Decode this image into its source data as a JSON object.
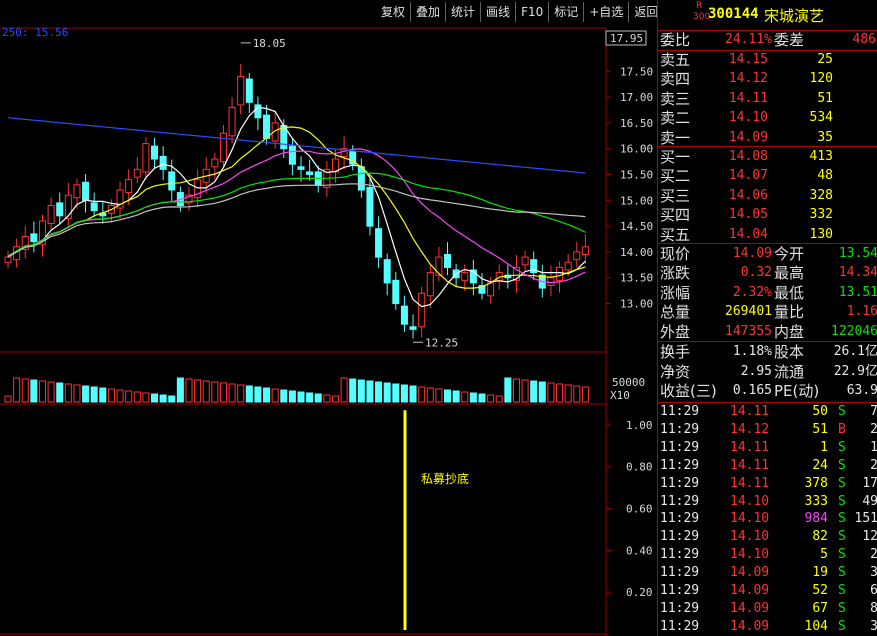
{
  "toolbar": [
    "复权",
    "叠加",
    "统计",
    "画线",
    "F10",
    "标记",
    "+自选",
    "返回"
  ],
  "stock": {
    "badge_r": "R",
    "badge_num": "300",
    "code": "300144",
    "name": "宋城演艺"
  },
  "price_chart": {
    "ma_label": "250: 15.56",
    "current_price_tag": "17.95",
    "high_annotation": "18.05",
    "low_annotation": "12.25",
    "y_labels": [
      "17.50",
      "17.00",
      "16.50",
      "16.00",
      "15.50",
      "15.00",
      "14.50",
      "14.00",
      "13.50",
      "13.00"
    ],
    "y_values": [
      17.5,
      17.0,
      16.5,
      16.0,
      15.5,
      15.0,
      14.5,
      14.0,
      13.5,
      13.0
    ],
    "ylim": [
      12.1,
      18.3
    ]
  },
  "volume_chart": {
    "scale_label": "50000",
    "multiplier": "X10"
  },
  "indicator_chart": {
    "signal_label": "私募抄底",
    "y_labels": [
      "1.00",
      "0.80",
      "0.60",
      "0.40",
      "0.20"
    ],
    "y_values": [
      1.0,
      0.8,
      0.6,
      0.4,
      0.2
    ],
    "ylim": [
      0,
      1.1
    ]
  },
  "book_summary": {
    "ratio_label": "委比",
    "ratio_value": "24.11%",
    "diff_label": "委差",
    "diff_value": "486"
  },
  "asks": [
    {
      "label": "卖五",
      "price": "14.15",
      "vol": "25"
    },
    {
      "label": "卖四",
      "price": "14.12",
      "vol": "120"
    },
    {
      "label": "卖三",
      "price": "14.11",
      "vol": "51"
    },
    {
      "label": "卖二",
      "price": "14.10",
      "vol": "534"
    },
    {
      "label": "卖一",
      "price": "14.09",
      "vol": "35"
    }
  ],
  "bids": [
    {
      "label": "买一",
      "price": "14.08",
      "vol": "413"
    },
    {
      "label": "买二",
      "price": "14.07",
      "vol": "48"
    },
    {
      "label": "买三",
      "price": "14.06",
      "vol": "328"
    },
    {
      "label": "买四",
      "price": "14.05",
      "vol": "332"
    },
    {
      "label": "买五",
      "price": "14.04",
      "vol": "130"
    }
  ],
  "stats": [
    {
      "l1": "现价",
      "v1": "14.09",
      "c1": "red",
      "l2": "今开",
      "v2": "13.54",
      "c2": "grn"
    },
    {
      "l1": "涨跌",
      "v1": "0.32",
      "c1": "red",
      "l2": "最高",
      "v2": "14.34",
      "c2": "red"
    },
    {
      "l1": "涨幅",
      "v1": "2.32%",
      "c1": "red",
      "l2": "最低",
      "v2": "13.51",
      "c2": "grn"
    },
    {
      "l1": "总量",
      "v1": "269401",
      "c1": "yel",
      "l2": "量比",
      "v2": "1.16",
      "c2": "red"
    },
    {
      "l1": "外盘",
      "v1": "147355",
      "c1": "red",
      "l2": "内盘",
      "v2": "122046",
      "c2": "grn"
    }
  ],
  "fundamentals": [
    {
      "l1": "换手",
      "v1": "1.18%",
      "l2": "股本",
      "v2": "26.1亿"
    },
    {
      "l1": "净资",
      "v1": "2.95",
      "l2": "流通",
      "v2": "22.9亿"
    },
    {
      "l1": "收益(三)",
      "v1": "0.165",
      "l2": "PE(动)",
      "v2": "63.9"
    }
  ],
  "ticks": [
    {
      "time": "11:29",
      "price": "14.11",
      "vol": "50",
      "side": "S",
      "extra": "7"
    },
    {
      "time": "11:29",
      "price": "14.12",
      "vol": "51",
      "side": "B",
      "extra": "2"
    },
    {
      "time": "11:29",
      "price": "14.11",
      "vol": "1",
      "side": "S",
      "extra": "1"
    },
    {
      "time": "11:29",
      "price": "14.11",
      "vol": "24",
      "side": "S",
      "extra": "2"
    },
    {
      "time": "11:29",
      "price": "14.11",
      "vol": "378",
      "side": "S",
      "extra": "17"
    },
    {
      "time": "11:29",
      "price": "14.10",
      "vol": "333",
      "side": "S",
      "extra": "49"
    },
    {
      "time": "11:29",
      "price": "14.10",
      "vol": "984",
      "side": "S",
      "extra": "151"
    },
    {
      "time": "11:29",
      "price": "14.10",
      "vol": "82",
      "side": "S",
      "extra": "12"
    },
    {
      "time": "11:29",
      "price": "14.10",
      "vol": "5",
      "side": "S",
      "extra": "2"
    },
    {
      "time": "11:29",
      "price": "14.09",
      "vol": "19",
      "side": "S",
      "extra": "3"
    },
    {
      "time": "11:29",
      "price": "14.09",
      "vol": "52",
      "side": "S",
      "extra": "6"
    },
    {
      "time": "11:29",
      "price": "14.09",
      "vol": "67",
      "side": "S",
      "extra": "8"
    },
    {
      "time": "11:29",
      "price": "14.09",
      "vol": "104",
      "side": "S",
      "extra": "3"
    }
  ],
  "colors": {
    "up": "#ff3232",
    "down": "#54ffff",
    "ma5": "#ffffff",
    "ma10": "#ffff00",
    "ma20": "#ff40ff",
    "ma60": "#00e600",
    "ma120": "#c0c0c0",
    "ma250": "#2a4cff",
    "grid": "#a00000"
  }
}
